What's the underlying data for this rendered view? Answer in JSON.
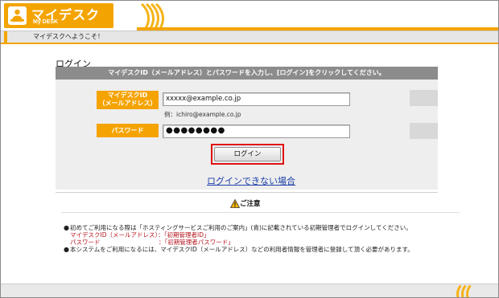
{
  "app": {
    "logo_title": "マイデスク",
    "logo_subtitle": "My DESK"
  },
  "welcome": "マイデスクへようこそ！",
  "login": {
    "title": "ログイン",
    "instruction": "マイデスクID（メールアドレス）とパスワードを入力し、[ログイン]をクリックしてください。",
    "id_label_line1": "マイデスクID",
    "id_label_line2": "（メールアドレス）",
    "id_value": "xxxxx@example.co.jp",
    "id_hint": "例：ichiro@example.co.jp",
    "password_label": "パスワード",
    "password_value": "●●●●●●●●",
    "login_button": "ログイン",
    "cant_login_link": "ログインできない場合"
  },
  "notice": {
    "title": "ご注意",
    "item1": "初めてご利用になる際は「ホスティングサービスご利用のご案内」(青)に記載されている初期管理者でログインしてください。",
    "item1_sub1_label": "マイデスクID（メールアドレス）：",
    "item1_sub1_value": "「初期管理者ID」",
    "item1_sub2_label": "パスワード",
    "item1_sub2_value": "：「初期管理者パスワード」",
    "item2": "本システムをご利用になるには、マイデスクID（メールアドレス）などの利用者情報を管理者に登録して頂く必要があります。"
  },
  "colors": {
    "brand": "#f4a400",
    "highlight": "#e01010",
    "link": "#1a3ea8"
  },
  "icons": {
    "logo": "desk-person-icon",
    "warning": "warning-icon"
  }
}
